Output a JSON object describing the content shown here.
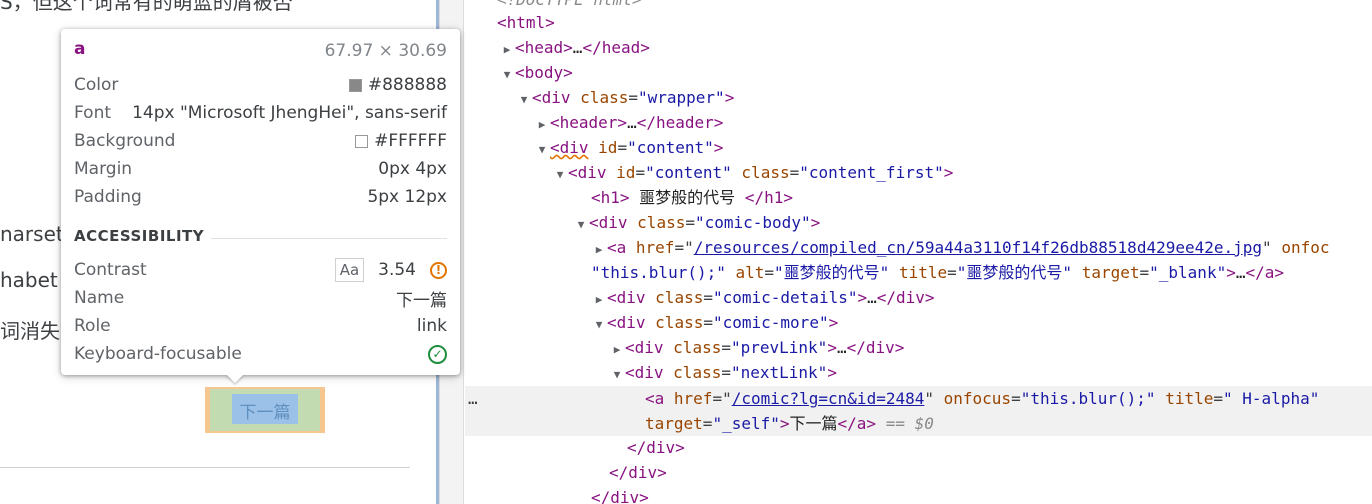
{
  "page": {
    "text_line1": "S，但这个词常有的萌蓝的屑被否",
    "text_line2": "narset",
    "text_line3": "habet",
    "text_line4": "词消失",
    "link_text": "下一篇"
  },
  "tooltip": {
    "tag": "a",
    "size": "67.97 × 30.69",
    "rows": {
      "color_label": "Color",
      "color_value": "#888888",
      "color_swatch": "#888888",
      "font_label": "Font",
      "font_value": "14px \"Microsoft JhengHei\", sans-serif",
      "background_label": "Background",
      "background_value": "#FFFFFF",
      "background_swatch": "#FFFFFF",
      "margin_label": "Margin",
      "margin_value": "0px 4px",
      "padding_label": "Padding",
      "padding_value": "5px 12px"
    },
    "accessibility": {
      "title": "ACCESSIBILITY",
      "contrast_label": "Contrast",
      "contrast_badge": "Aa",
      "contrast_value": "3.54",
      "name_label": "Name",
      "name_value": "下一篇",
      "role_label": "Role",
      "role_value": "link",
      "focusable_label": "Keyboard-focusable"
    }
  },
  "elements": {
    "lines": [
      {
        "t1": "<!DOCTYPE html>"
      },
      {
        "t1": "<html>"
      },
      {
        "t1": "<head>",
        "t2": "…",
        "t3": "</head>"
      },
      {
        "t1": "<body>"
      },
      {
        "t1": "<div",
        "a1": "class",
        "v1": "\"wrapper\"",
        "t3": ">"
      },
      {
        "t1": "<header>",
        "t2": "…",
        "t3": "</header>"
      },
      {
        "t1": "<div",
        "a1": "id",
        "v1": "\"content\"",
        "t3": ">"
      },
      {
        "t1": "<div",
        "a1": "id",
        "v1": "\"content\"",
        "a2": "class",
        "v2": "\"content_first\"",
        "t3": ">"
      },
      {
        "t1": "<h1>",
        "t2": " 噩梦般的代号 ",
        "t3": "</h1>"
      },
      {
        "t1": "<div",
        "a1": "class",
        "v1": "\"comic-body\"",
        "t3": ">"
      },
      {
        "t1": "<a",
        "a1": "href",
        "v1": "/resources/compiled_cn/59a44a3110f14f26db88518d429ee42e.jpg",
        "a2": "onfoc"
      },
      {
        "v0": "\"this.blur();\"",
        "a1": "alt",
        "v1": "\"噩梦般的代号\"",
        "a2": "title",
        "v2": "\"噩梦般的代号\"",
        "a3": "target",
        "v3": "\"_blank\"",
        "t2": "…",
        "t3": "</a>"
      },
      {
        "t1": "<div",
        "a1": "class",
        "v1": "\"comic-details\"",
        "t2": "…",
        "t3": "</div>"
      },
      {
        "t1": "<div",
        "a1": "class",
        "v1": "\"comic-more\"",
        "t3": ">"
      },
      {
        "t1": "<div",
        "a1": "class",
        "v1": "\"prevLink\"",
        "t2": "…",
        "t3": "</div>"
      },
      {
        "t1": "<div",
        "a1": "class",
        "v1": "\"nextLink\"",
        "t3": ">"
      },
      {
        "t1": "<a",
        "a1": "href",
        "v1": "/comic?lg=cn&id=2484",
        "a2": "onfocus",
        "v2": "\"this.blur();\"",
        "a3": "title",
        "v3": "\" H-alpha\""
      },
      {
        "a1": "target",
        "v1": "\"_self\"",
        "t2": "下一篇",
        "t3": "</a>",
        "dim": "== $0"
      },
      {
        "t1": "</div>"
      },
      {
        "t1": "</div>"
      },
      {
        "t1": "</div>"
      }
    ],
    "dots": "…"
  }
}
